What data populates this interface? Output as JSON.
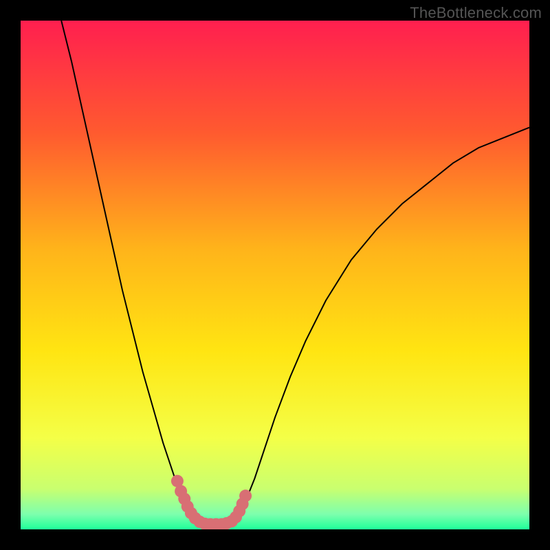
{
  "attribution": {
    "text": "TheBottleneck.com"
  },
  "chart_data": {
    "type": "line",
    "title": "",
    "xlabel": "",
    "ylabel": "",
    "xlim": [
      0,
      100
    ],
    "ylim": [
      0,
      100
    ],
    "background_gradient_stops": [
      {
        "y": 100,
        "color": "#ff1f4f"
      },
      {
        "y": 78,
        "color": "#ff5a2f"
      },
      {
        "y": 55,
        "color": "#ffb41a"
      },
      {
        "y": 35,
        "color": "#ffe512"
      },
      {
        "y": 18,
        "color": "#f4ff47"
      },
      {
        "y": 8,
        "color": "#c9ff6f"
      },
      {
        "y": 3,
        "color": "#7dffad"
      },
      {
        "y": 0,
        "color": "#1fff9a"
      }
    ],
    "curve_points_xy": [
      [
        8,
        100
      ],
      [
        10,
        92
      ],
      [
        12,
        83
      ],
      [
        14,
        74
      ],
      [
        16,
        65
      ],
      [
        18,
        56
      ],
      [
        20,
        47
      ],
      [
        22,
        39
      ],
      [
        24,
        31
      ],
      [
        26,
        24
      ],
      [
        28,
        17
      ],
      [
        30,
        11
      ],
      [
        31,
        8
      ],
      [
        32,
        6
      ],
      [
        33,
        4
      ],
      [
        34,
        2.5
      ],
      [
        35,
        1.5
      ],
      [
        36,
        1
      ],
      [
        37,
        1
      ],
      [
        38,
        1
      ],
      [
        39,
        1
      ],
      [
        40,
        1
      ],
      [
        41,
        1
      ],
      [
        42,
        1.5
      ],
      [
        43,
        3
      ],
      [
        44,
        5
      ],
      [
        46,
        10
      ],
      [
        48,
        16
      ],
      [
        50,
        22
      ],
      [
        53,
        30
      ],
      [
        56,
        37
      ],
      [
        60,
        45
      ],
      [
        65,
        53
      ],
      [
        70,
        59
      ],
      [
        75,
        64
      ],
      [
        80,
        68
      ],
      [
        85,
        72
      ],
      [
        90,
        75
      ],
      [
        95,
        77
      ],
      [
        100,
        79
      ]
    ],
    "markers_xy": [
      [
        30.8,
        9.5
      ],
      [
        31.5,
        7.5
      ],
      [
        32.2,
        6.0
      ],
      [
        32.8,
        4.5
      ],
      [
        33.5,
        3.2
      ],
      [
        34.3,
        2.2
      ],
      [
        35.2,
        1.5
      ],
      [
        36.2,
        1.1
      ],
      [
        37.3,
        1.0
      ],
      [
        38.4,
        1.0
      ],
      [
        39.5,
        1.0
      ],
      [
        40.5,
        1.2
      ],
      [
        41.5,
        1.6
      ],
      [
        42.3,
        2.4
      ],
      [
        43.0,
        3.6
      ],
      [
        43.6,
        5.0
      ],
      [
        44.2,
        6.6
      ]
    ],
    "curve_color": "#000000",
    "marker_color": "#d86f74"
  }
}
